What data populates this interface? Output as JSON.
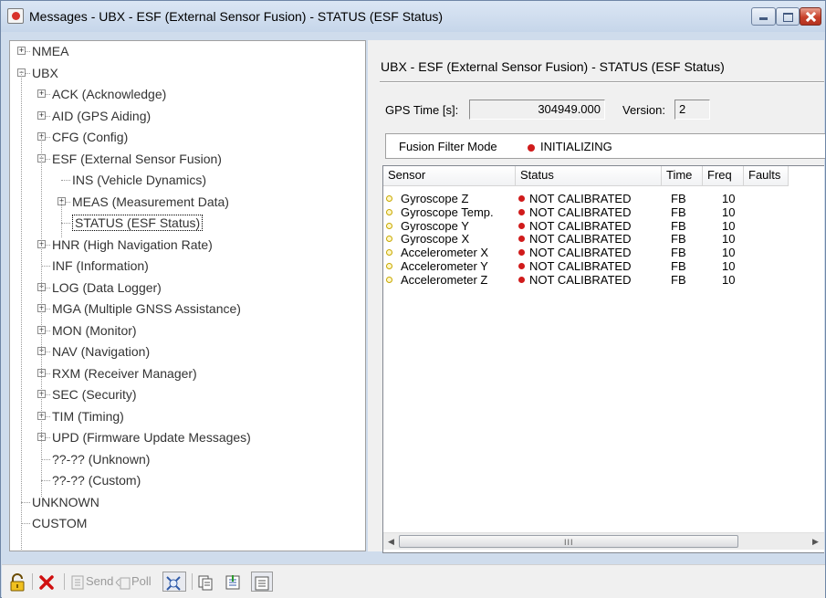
{
  "window": {
    "title": "Messages - UBX - ESF (External Sensor Fusion) - STATUS (ESF Status)"
  },
  "tree": {
    "items": [
      {
        "label": "NMEA",
        "expander": "+"
      },
      {
        "label": "UBX",
        "expander": "-"
      },
      {
        "label": "ACK (Acknowledge)",
        "expander": "+"
      },
      {
        "label": "AID (GPS Aiding)",
        "expander": "+"
      },
      {
        "label": "CFG (Config)",
        "expander": "+"
      },
      {
        "label": "ESF (External Sensor Fusion)",
        "expander": "-"
      },
      {
        "label": "INS (Vehicle Dynamics)",
        "expander": ""
      },
      {
        "label": "MEAS (Measurement Data)",
        "expander": "+"
      },
      {
        "label": "STATUS (ESF Status)",
        "expander": ""
      },
      {
        "label": "HNR (High Navigation Rate)",
        "expander": "+"
      },
      {
        "label": "INF (Information)",
        "expander": ""
      },
      {
        "label": "LOG (Data Logger)",
        "expander": "+"
      },
      {
        "label": "MGA (Multiple GNSS Assistance)",
        "expander": "+"
      },
      {
        "label": "MON (Monitor)",
        "expander": "+"
      },
      {
        "label": "NAV (Navigation)",
        "expander": "+"
      },
      {
        "label": "RXM (Receiver Manager)",
        "expander": "+"
      },
      {
        "label": "SEC (Security)",
        "expander": "+"
      },
      {
        "label": "TIM (Timing)",
        "expander": "+"
      },
      {
        "label": "UPD (Firmware Update Messages)",
        "expander": "+"
      },
      {
        "label": "??-?? (Unknown)",
        "expander": ""
      },
      {
        "label": "??-?? (Custom)",
        "expander": ""
      },
      {
        "label": "UNKNOWN",
        "expander": ""
      },
      {
        "label": "CUSTOM",
        "expander": ""
      }
    ]
  },
  "status_panel": {
    "heading": "UBX - ESF (External Sensor Fusion) - STATUS (ESF Status)",
    "gps_time_label": "GPS Time [s]:",
    "gps_time_value": "304949.000",
    "version_label": "Version:",
    "version_value": "2",
    "fusion_label": "Fusion Filter Mode",
    "fusion_value": "INITIALIZING",
    "status_color": "#d01b1b"
  },
  "sensor_table": {
    "headers": [
      "Sensor",
      "Status",
      "Time",
      "Freq",
      "Faults"
    ],
    "rows": [
      {
        "sensor": "Gyroscope Z",
        "status": "NOT CALIBRATED",
        "time": "FB",
        "freq": "10"
      },
      {
        "sensor": "Gyroscope Temp.",
        "status": "NOT CALIBRATED",
        "time": "FB",
        "freq": "10"
      },
      {
        "sensor": "Gyroscope Y",
        "status": "NOT CALIBRATED",
        "time": "FB",
        "freq": "10"
      },
      {
        "sensor": "Gyroscope X",
        "status": "NOT CALIBRATED",
        "time": "FB",
        "freq": "10"
      },
      {
        "sensor": "Accelerometer X",
        "status": "NOT CALIBRATED",
        "time": "FB",
        "freq": "10"
      },
      {
        "sensor": "Accelerometer Y",
        "status": "NOT CALIBRATED",
        "time": "FB",
        "freq": "10"
      },
      {
        "sensor": "Accelerometer Z",
        "status": "NOT CALIBRATED",
        "time": "FB",
        "freq": "10"
      }
    ],
    "scrollbar_grip": "III"
  },
  "toolbar": {
    "send_label": "Send",
    "poll_label": "Poll",
    "icons": [
      "lock-icon",
      "delete-icon",
      "send-icon",
      "poll-icon",
      "autoupdate-icon",
      "copy-icon",
      "import-icon",
      "export-icon"
    ]
  }
}
